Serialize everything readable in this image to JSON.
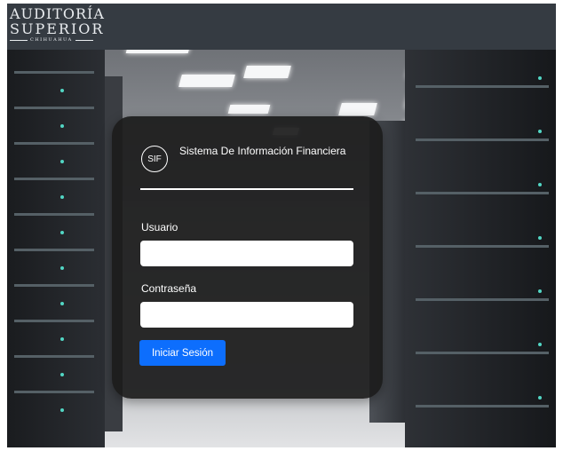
{
  "header": {
    "logo": {
      "line1": "AUDITORÍA",
      "line2": "SUPERIOR",
      "line3": "CHIHUAHUA"
    }
  },
  "login": {
    "badge": "SIF",
    "title": "Sistema De Información Financiera",
    "username_label": "Usuario",
    "username_value": "",
    "password_label": "Contraseña",
    "password_value": "",
    "submit_label": "Iniciar Sesión"
  },
  "colors": {
    "header_bg": "#353b42",
    "card_bg": "#1c1c1c",
    "button_bg": "#0d6efd"
  }
}
